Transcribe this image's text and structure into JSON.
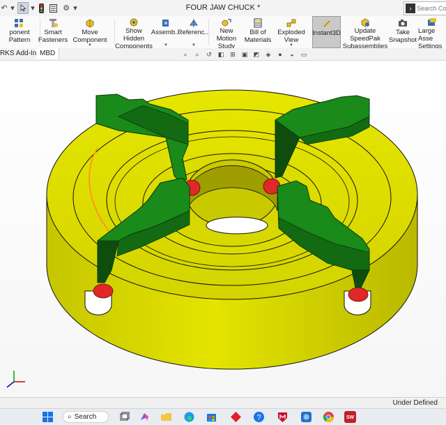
{
  "window": {
    "title": "FOUR JAW CHUCK *"
  },
  "search": {
    "placeholder": "Search Comm"
  },
  "ribbon": {
    "buttons": [
      {
        "label": "ponent Pattern",
        "icon": "component-pattern-icon"
      },
      {
        "label": "Smart\nFasteners",
        "icon": "smart-fasteners-icon"
      },
      {
        "label": "Move Component",
        "icon": "move-component-icon"
      },
      {
        "label": "Show Hidden\nComponents",
        "icon": "show-hidden-icon"
      },
      {
        "label": "Assemb...",
        "icon": "assembly-features-icon"
      },
      {
        "label": "Referenc...",
        "icon": "reference-geometry-icon"
      },
      {
        "label": "New Motion\nStudy",
        "icon": "motion-study-icon"
      },
      {
        "label": "Bill of\nMaterials",
        "icon": "bill-of-materials-icon"
      },
      {
        "label": "Exploded View",
        "icon": "exploded-view-icon"
      },
      {
        "label": "Instant3D",
        "icon": "instant3d-icon",
        "active": true
      },
      {
        "label": "Update SpeedPak\nSubassemblies",
        "icon": "speedpak-icon"
      },
      {
        "label": "Take\nSnapshot",
        "icon": "snapshot-icon"
      },
      {
        "label": "Large Asse\nSettings",
        "icon": "large-assembly-icon"
      }
    ]
  },
  "tabs": [
    {
      "label": "RKS Add-Ins"
    },
    {
      "label": "MBD"
    }
  ],
  "status": {
    "text": "Under Defined"
  },
  "taskbar": {
    "search_label": "Search"
  },
  "colors": {
    "body": "#dede00",
    "body_dark": "#b5b500",
    "jaw": "#1a7a1a",
    "jaw_dark": "#0f4d0f",
    "screw": "#e03030",
    "active_button": "#c9c9c9"
  }
}
